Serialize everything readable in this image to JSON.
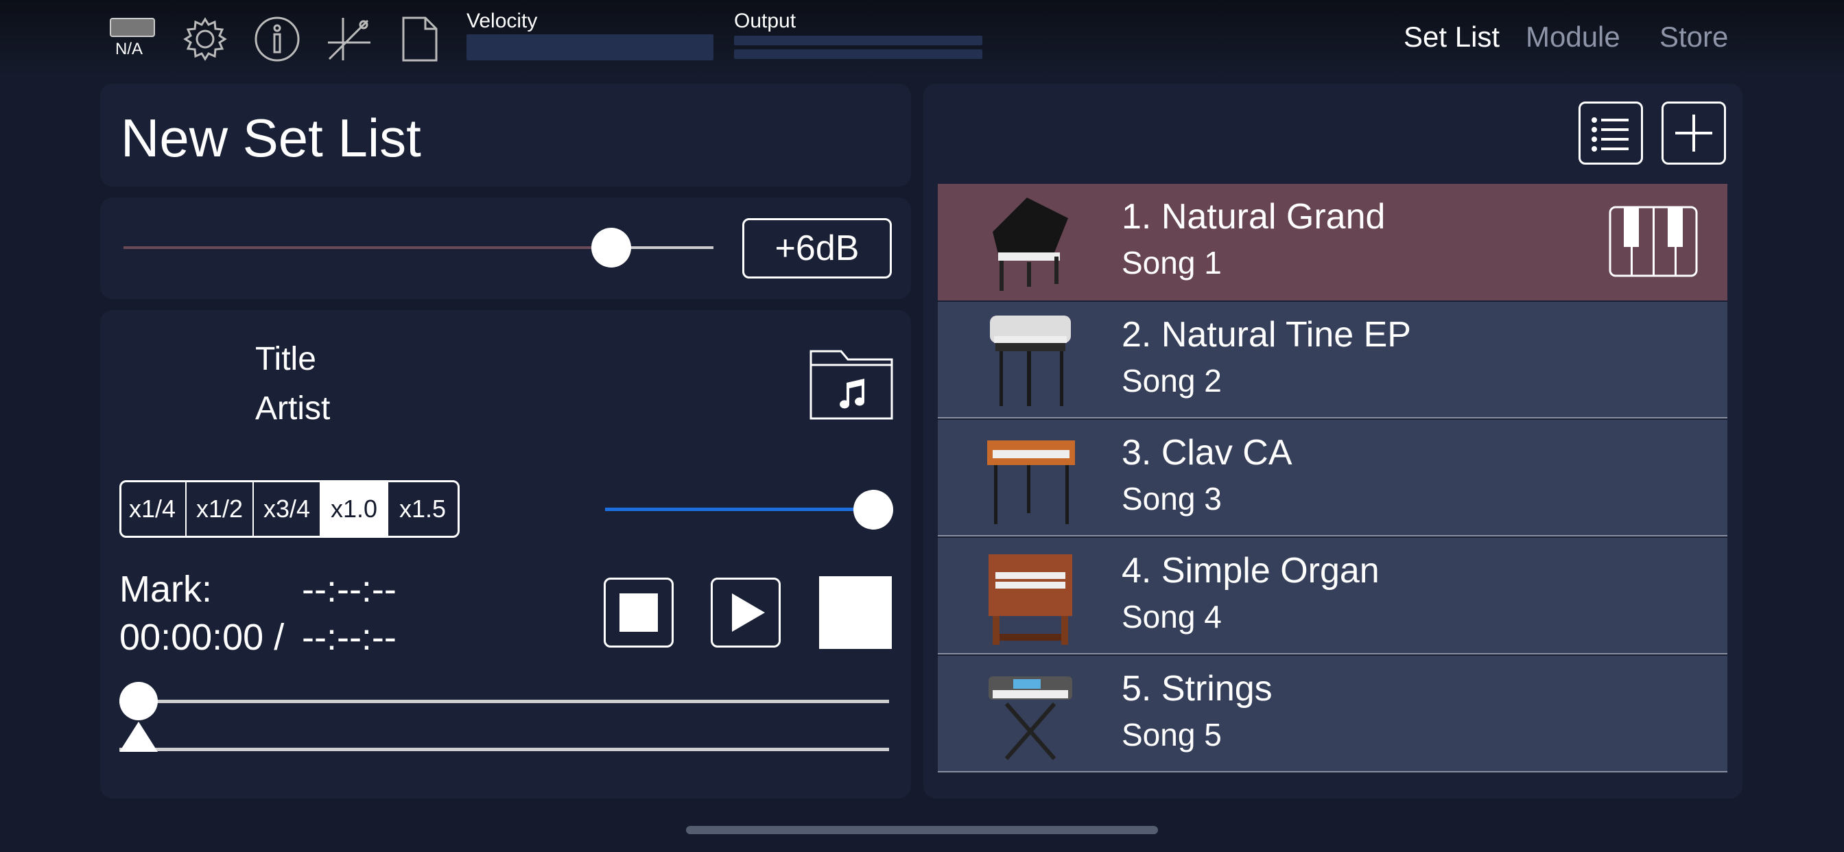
{
  "status": {
    "battery_label": "N/A"
  },
  "meters": {
    "velocity_label": "Velocity",
    "output_label": "Output"
  },
  "nav": {
    "set_list": "Set List",
    "module": "Module",
    "store": "Store"
  },
  "setlist": {
    "title": "New Set List"
  },
  "volume": {
    "gain_label": "+6dB",
    "level_fraction": 0.82
  },
  "player": {
    "title": "Title",
    "artist": "Artist",
    "speeds": [
      "x1/4",
      "x1/2",
      "x3/4",
      "x1.0",
      "x1.5"
    ],
    "selected_speed": "x1.0",
    "mark_label": "Mark:",
    "mark_time": "--:--:--",
    "position": "00:00:00 /",
    "duration": "--:--:--",
    "speed_slider_fraction": 1.0
  },
  "songs": [
    {
      "name": "1. Natural Grand",
      "song": "Song 1",
      "selected": true
    },
    {
      "name": "2. Natural Tine EP",
      "song": "Song 2",
      "selected": false
    },
    {
      "name": "3. Clav CA",
      "song": "Song 3",
      "selected": false
    },
    {
      "name": "4. Simple Organ",
      "song": "Song 4",
      "selected": false
    },
    {
      "name": "5. Strings",
      "song": "Song 5",
      "selected": false
    }
  ],
  "colors": {
    "selected_row": "#684553",
    "row": "#37405a",
    "accent_blue": "#1e6fe0"
  }
}
